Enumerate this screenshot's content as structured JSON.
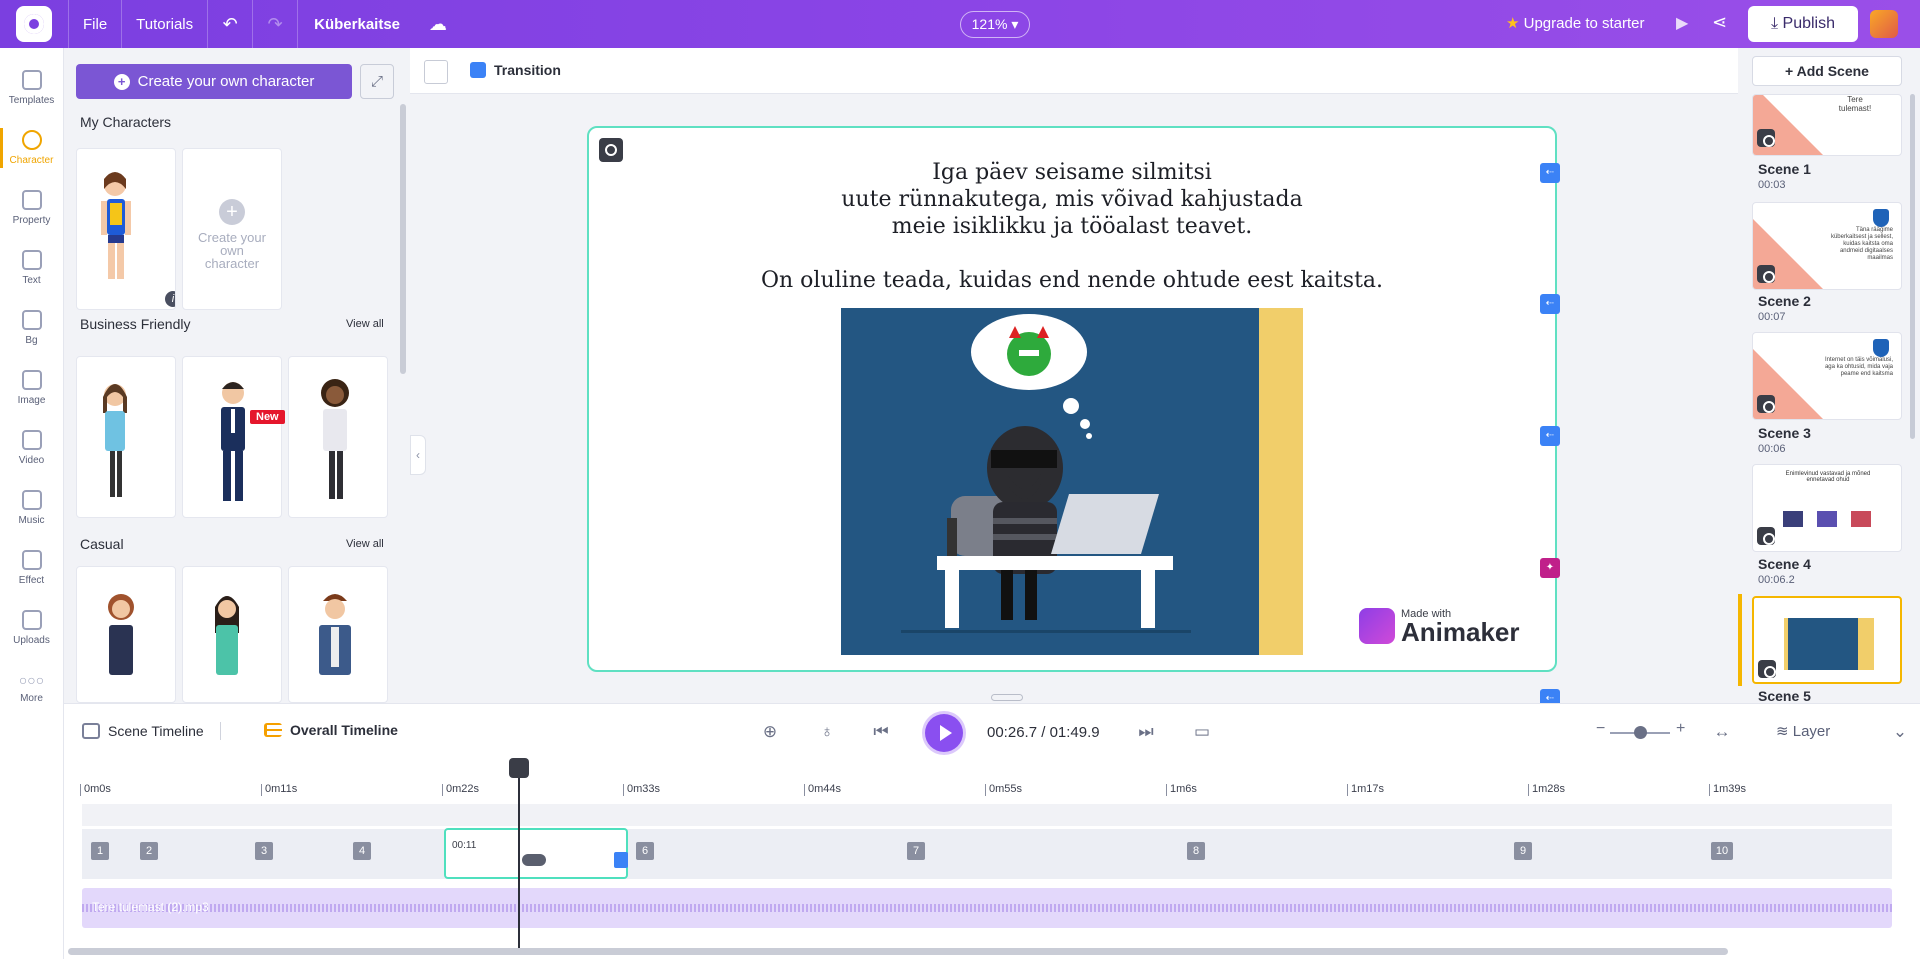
{
  "topbar": {
    "file": "File",
    "tutorials": "Tutorials",
    "project_title": "Küberkaitse",
    "zoom": "121%",
    "upgrade": "Upgrade to starter",
    "publish": "Publish"
  },
  "rail": [
    {
      "label": "Templates",
      "icon": "templates-icon"
    },
    {
      "label": "Character",
      "icon": "character-icon",
      "active": true
    },
    {
      "label": "Property",
      "icon": "property-icon"
    },
    {
      "label": "Text",
      "icon": "text-icon"
    },
    {
      "label": "Bg",
      "icon": "bg-icon"
    },
    {
      "label": "Image",
      "icon": "image-icon"
    },
    {
      "label": "Video",
      "icon": "video-icon"
    },
    {
      "label": "Music",
      "icon": "music-icon"
    },
    {
      "label": "Effect",
      "icon": "effect-icon"
    },
    {
      "label": "Uploads",
      "icon": "uploads-icon"
    },
    {
      "label": "More",
      "icon": "more-icon"
    }
  ],
  "charpanel": {
    "create_button": "Create your own character",
    "my_characters": "My Characters",
    "create_card": "Create your own character",
    "business_friendly": "Business Friendly",
    "casual": "Casual",
    "view_all": "View all",
    "new_badge": "New"
  },
  "canvas_toolbar": {
    "transition": "Transition"
  },
  "slide": {
    "line1": "Iga päev seisame silmitsi",
    "line2": "uute rünnakutega, mis võivad kahjustada",
    "line3": "meie isiklikku ja tööalast teavet.",
    "line4": "On oluline teada, kuidas end nende ohtude eest kaitsta.",
    "watermark_small": "Made with",
    "watermark_big": "Animaker"
  },
  "scenes": {
    "add_scene": "+ Add Scene",
    "items": [
      {
        "name": "Scene 1",
        "time": "00:03"
      },
      {
        "name": "Scene 2",
        "time": "00:07"
      },
      {
        "name": "Scene 3",
        "time": "00:06"
      },
      {
        "name": "Scene 4",
        "time": "00:06.2"
      },
      {
        "name": "Scene 5",
        "time": ""
      }
    ],
    "thumb1_text": "Tere tulemast!",
    "thumb2_text": "Täna räägime küberkaitsest ja sellest, kuidas kaitsta oma andmeid digitaalses maailmas",
    "thumb3_text": "Internet on täis võimalusi, aga ka ohtusid, mida vaja peame end kaitsma",
    "thumb4_text": "Enimlevinud vastavad ja mõned ennetavad ohud"
  },
  "timeline": {
    "scene_timeline": "Scene Timeline",
    "overall_timeline": "Overall Timeline",
    "current_time": "00:26.7",
    "separator": "/",
    "total_time": "01:49.9",
    "layer": "Layer",
    "ruler": [
      "0m0s",
      "0m11s",
      "0m22s",
      "0m33s",
      "0m44s",
      "0m55s",
      "1m6s",
      "1m17s",
      "1m28s",
      "1m39s"
    ],
    "scene_numbers": [
      "1",
      "2",
      "3",
      "4",
      "6",
      "7",
      "8",
      "9",
      "10"
    ],
    "selected_duration": "00:11",
    "audio_file": "Tere tulemast (2).mp3"
  }
}
